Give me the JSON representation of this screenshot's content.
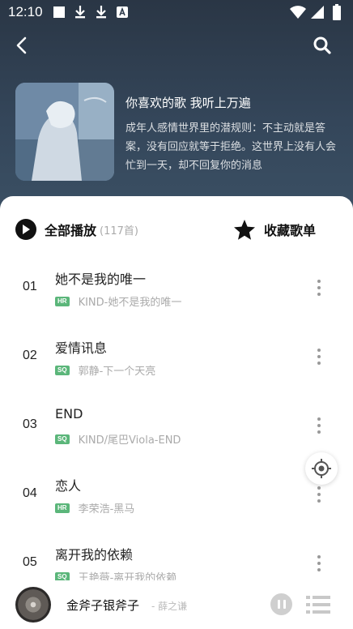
{
  "status_bar": {
    "time": "12:10",
    "icons": [
      "square-icon",
      "download-icon",
      "download-icon",
      "a-icon",
      "wifi-icon",
      "signal-icon",
      "battery-icon"
    ]
  },
  "nav": {
    "back_icon": "back-arrow-icon",
    "search_icon": "search-icon"
  },
  "playlist": {
    "title": "你喜欢的歌 我听上万遍",
    "description": "成年人感情世界里的潜规则：不主动就是答案，没有回应就等于拒绝。这世界上没有人会忙到一天，却不回复你的消息"
  },
  "actions": {
    "play_all_label": "全部播放",
    "play_all_count": "(117首)",
    "collect_label": "收藏歌单"
  },
  "songs": [
    {
      "index": "01",
      "title": "她不是我的唯一",
      "quality": "HR",
      "artist": "KIND-她不是我的唯一"
    },
    {
      "index": "02",
      "title": "爱情讯息",
      "quality": "SQ",
      "artist": "郭静-下一个天亮"
    },
    {
      "index": "03",
      "title": "END",
      "quality": "SQ",
      "artist": "KIND/尾巴Viola-END"
    },
    {
      "index": "04",
      "title": "恋人",
      "quality": "HR",
      "artist": "李荣浩-黑马"
    },
    {
      "index": "05",
      "title": "离开我的依赖",
      "quality": "SQ",
      "artist": "王艳薇-离开我的依赖"
    }
  ],
  "player": {
    "title": "金斧子银斧子",
    "artist": "- 薛之谦",
    "pause_icon": "pause-icon",
    "queue_icon": "playlist-queue-icon"
  },
  "colors": {
    "header_bg": "#2d3a4a",
    "badge_green": "#5bb67a",
    "text_primary": "#222222",
    "text_secondary": "#aaaaaa"
  }
}
